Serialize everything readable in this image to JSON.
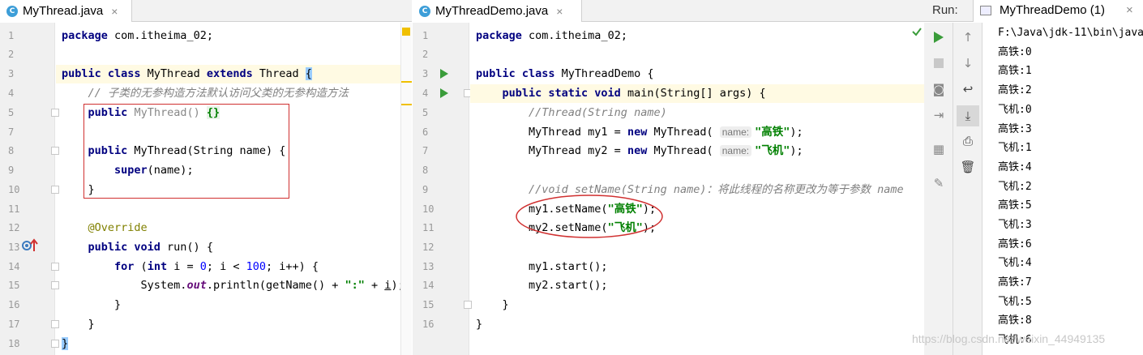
{
  "left_editor": {
    "tab_title": "MyThread.java",
    "tab_icon": "C",
    "line_numbers": [
      "1",
      "2",
      "3",
      "4",
      "5",
      "7",
      "8",
      "9",
      "10",
      "11",
      "12",
      "13",
      "14",
      "15",
      "16",
      "17",
      "18"
    ]
  },
  "right_editor": {
    "tab_title": "MyThreadDemo.java",
    "tab_icon": "C",
    "line_numbers": [
      "1",
      "2",
      "3",
      "4",
      "5",
      "6",
      "7",
      "8",
      "9",
      "10",
      "11",
      "12",
      "13",
      "14",
      "15",
      "16"
    ]
  },
  "run_panel": {
    "label": "Run:",
    "config_name": "MyThreadDemo (1)",
    "console_lines": [
      "F:\\Java\\jdk-11\\bin\\java",
      "高铁:0",
      "高铁:1",
      "高铁:2",
      "飞机:0",
      "高铁:3",
      "飞机:1",
      "高铁:4",
      "飞机:2",
      "高铁:5",
      "飞机:3",
      "高铁:6",
      "飞机:4",
      "高铁:7",
      "飞机:5",
      "高铁:8",
      "飞机:6"
    ]
  },
  "watermark": "https://blog.csdn.net/weixin_44949135",
  "colors": {
    "keyword": "#000080",
    "string": "#008000",
    "comment": "#808080",
    "annotation": "#808000",
    "red_marker": "#d03030"
  }
}
